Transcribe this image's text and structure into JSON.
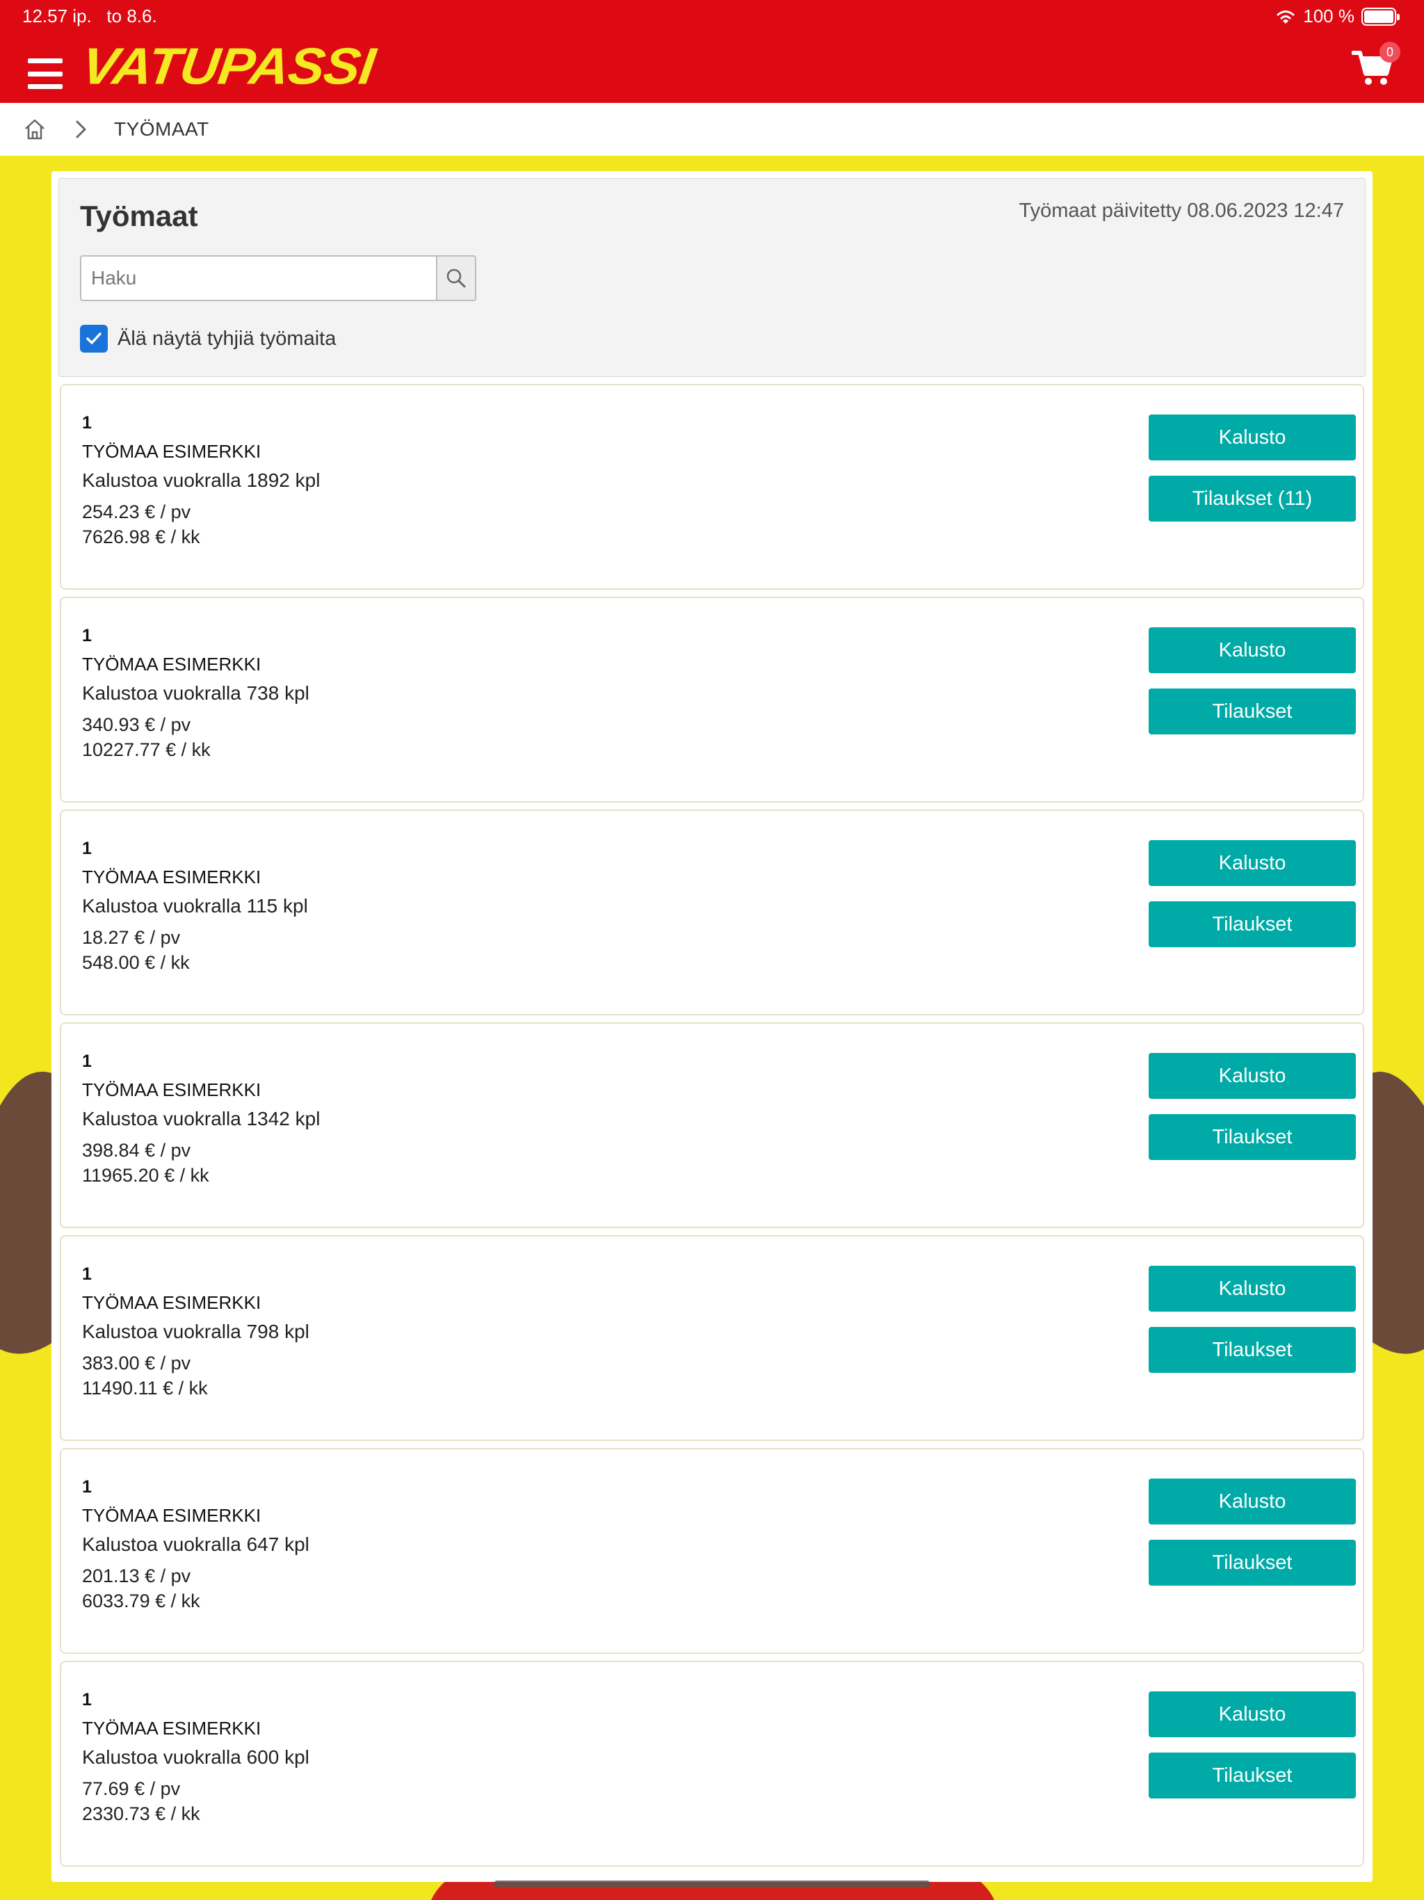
{
  "status": {
    "time": "12.57 ip.",
    "date": "to 8.6.",
    "battery": "100 %"
  },
  "header": {
    "logo": "VATUPASSI",
    "cart_count": "0"
  },
  "breadcrumb": {
    "current": "TYÖMAAT"
  },
  "panel": {
    "title": "Työmaat",
    "updated": "Työmaat päivitetty 08.06.2023 12:47",
    "search_placeholder": "Haku",
    "checkbox_label": "Älä näytä tyhjiä työmaita",
    "checkbox_checked": true
  },
  "sites": [
    {
      "number": "1",
      "name": "TYÖMAA ESIMERKKI",
      "count": "Kalustoa vuokralla 1892 kpl",
      "per_day": "254.23 € / pv",
      "per_month": "7626.98 € / kk",
      "kalusto": "Kalusto",
      "tilaukset": "Tilaukset (11)"
    },
    {
      "number": "1",
      "name": "TYÖMAA ESIMERKKI",
      "count": "Kalustoa vuokralla 738 kpl",
      "per_day": "340.93 € / pv",
      "per_month": "10227.77 € / kk",
      "kalusto": "Kalusto",
      "tilaukset": "Tilaukset"
    },
    {
      "number": "1",
      "name": "TYÖMAA ESIMERKKI",
      "count": "Kalustoa vuokralla 115 kpl",
      "per_day": "18.27 € / pv",
      "per_month": "548.00 € / kk",
      "kalusto": "Kalusto",
      "tilaukset": "Tilaukset"
    },
    {
      "number": "1",
      "name": "TYÖMAA ESIMERKKI",
      "count": "Kalustoa vuokralla 1342 kpl",
      "per_day": "398.84 € / pv",
      "per_month": "11965.20 € / kk",
      "kalusto": "Kalusto",
      "tilaukset": "Tilaukset"
    },
    {
      "number": "1",
      "name": "TYÖMAA ESIMERKKI",
      "count": "Kalustoa vuokralla 798 kpl",
      "per_day": "383.00 € / pv",
      "per_month": "11490.11 € / kk",
      "kalusto": "Kalusto",
      "tilaukset": "Tilaukset"
    },
    {
      "number": "1",
      "name": "TYÖMAA ESIMERKKI",
      "count": "Kalustoa vuokralla 647 kpl",
      "per_day": "201.13 € / pv",
      "per_month": "6033.79 € / kk",
      "kalusto": "Kalusto",
      "tilaukset": "Tilaukset"
    },
    {
      "number": "1",
      "name": "TYÖMAA ESIMERKKI",
      "count": "Kalustoa vuokralla 600 kpl",
      "per_day": "77.69 € / pv",
      "per_month": "2330.73 € / kk",
      "kalusto": "Kalusto",
      "tilaukset": "Tilaukset"
    }
  ],
  "colors": {
    "brand_red": "#dd0a14",
    "brand_yellow": "#f2e61e",
    "button_teal": "#00aaa6",
    "checkbox_blue": "#1a73d9"
  }
}
